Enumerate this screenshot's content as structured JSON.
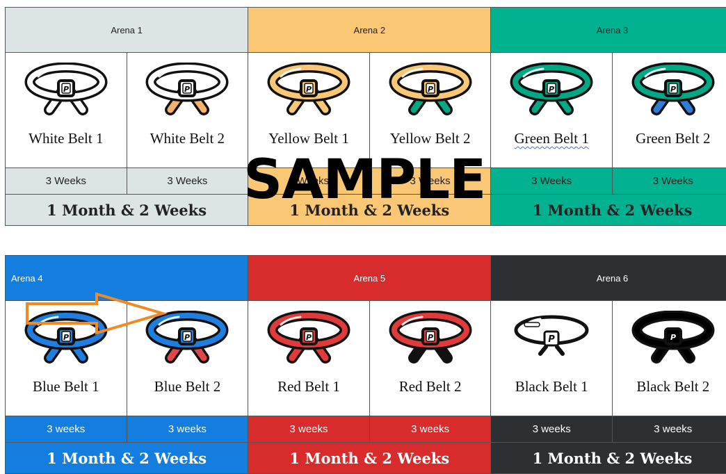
{
  "watermark": "SAMPLE",
  "colors": {
    "white": "#dde4e6",
    "yellow": "#fac874",
    "green": "#00b290",
    "blue": "#137ee0",
    "red": "#d82c2c",
    "black": "#2c3032",
    "arrow": "#f08a24"
  },
  "table1": {
    "arenas": [
      "Arena 1",
      "Arena 2",
      "Arena 3"
    ],
    "belts": [
      {
        "name": "White Belt 1",
        "icon": "white-belt-icon",
        "weeks": "3 Weeks"
      },
      {
        "name": "White Belt 2",
        "icon": "white-belt-orange-tips-icon",
        "weeks": "3 Weeks"
      },
      {
        "name": "Yellow Belt 1",
        "icon": "yellow-belt-icon",
        "weeks": "3 Weeks"
      },
      {
        "name": "Yellow Belt 2",
        "icon": "yellow-belt-green-tips-icon",
        "weeks": "3 Weeks"
      },
      {
        "name": "Green Belt 1",
        "icon": "green-belt-icon",
        "weeks": "3 Weeks"
      },
      {
        "name": "Green Belt 2",
        "icon": "green-belt-blue-tips-icon",
        "weeks": "3 Weeks"
      }
    ],
    "totals": [
      "1 Month & 2 Weeks",
      "1 Month & 2 Weeks",
      "1 Month & 2 Weeks"
    ]
  },
  "table2": {
    "arenas": [
      "Arena 4",
      "Arena 5",
      "Arena 6"
    ],
    "belts": [
      {
        "name": "Blue Belt 1",
        "icon": "blue-belt-icon",
        "weeks": "3 weeks"
      },
      {
        "name": "Blue Belt 2",
        "icon": "blue-belt-red-tips-icon",
        "weeks": "3 weeks"
      },
      {
        "name": "Red Belt 1",
        "icon": "red-belt-icon",
        "weeks": "3 weeks"
      },
      {
        "name": "Red Belt 2",
        "icon": "red-belt-black-tips-icon",
        "weeks": "3 weeks"
      },
      {
        "name": "Black Belt 1",
        "icon": "black-belt-outline-icon",
        "weeks": "3 weeks"
      },
      {
        "name": "Black Belt 2",
        "icon": "black-belt-solid-icon",
        "weeks": "3 weeks"
      }
    ],
    "totals": [
      "1 Month & 2 Weeks",
      "1 Month & 2 Weeks",
      "1 Month & 2 Weeks"
    ]
  }
}
